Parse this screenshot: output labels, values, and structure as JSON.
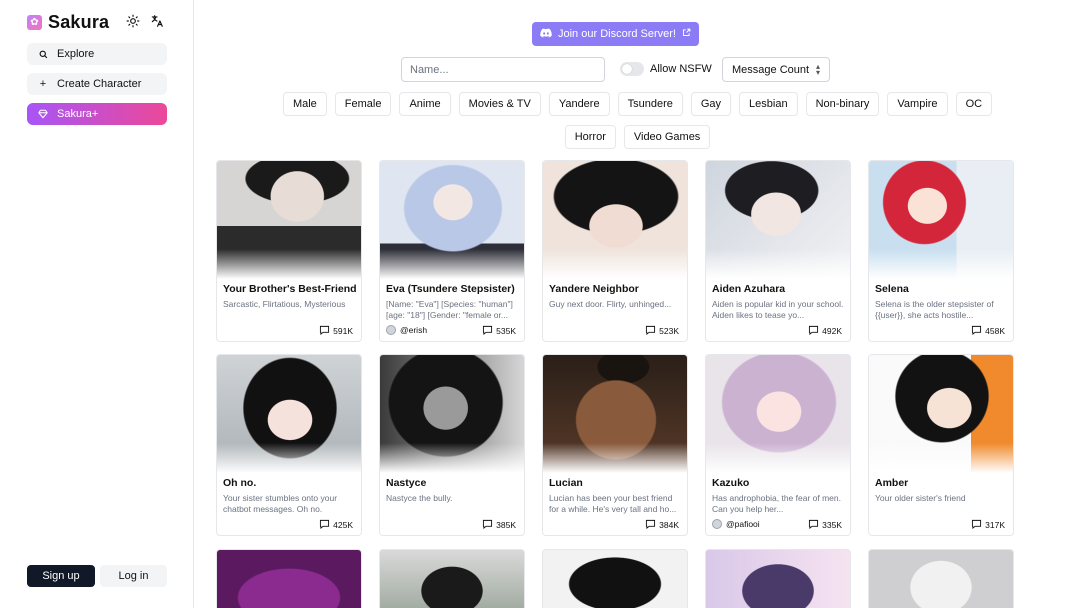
{
  "app": {
    "name": "Sakura"
  },
  "sidebar": {
    "items": [
      {
        "label": "Explore",
        "icon": "search-icon"
      },
      {
        "label": "Create Character",
        "icon": "plus-icon"
      },
      {
        "label": "Sakura+",
        "icon": "gem-icon"
      }
    ],
    "signup_label": "Sign up",
    "login_label": "Log in"
  },
  "header": {
    "discord_label": "Join our Discord Server!",
    "name_placeholder": "Name...",
    "nsfw_label": "Allow NSFW",
    "sort_value": "Message Count"
  },
  "tags": [
    "Male",
    "Female",
    "Anime",
    "Movies & TV",
    "Yandere",
    "Tsundere",
    "Gay",
    "Lesbian",
    "Non-binary",
    "Vampire",
    "OC",
    "Horror",
    "Video Games"
  ],
  "characters": [
    {
      "name": "Your Brother's Best-Friend",
      "desc": "Sarcastic, Flirtatious, Mysterious",
      "count": "591K",
      "creator": ""
    },
    {
      "name": "Eva (Tsundere Stepsister)",
      "desc": "[Name: \"Eva\"] [Species: \"human\"] [age: \"18\"] [Gender: \"female or...",
      "count": "535K",
      "creator": "@erish"
    },
    {
      "name": "Yandere Neighbor",
      "desc": "Guy next door. Flirty, unhinged...",
      "count": "523K",
      "creator": ""
    },
    {
      "name": "Aiden Azuhara",
      "desc": "Aiden is popular kid in your school. Aiden likes to tease yo...",
      "count": "492K",
      "creator": ""
    },
    {
      "name": "Selena",
      "desc": "Selena is the older stepsister of {{user}}, she acts hostile...",
      "count": "458K",
      "creator": ""
    },
    {
      "name": "Oh no.",
      "desc": "Your sister stumbles onto your chatbot messages. Oh no.",
      "count": "425K",
      "creator": ""
    },
    {
      "name": "Nastyce",
      "desc": "Nastyce the bully.",
      "count": "385K",
      "creator": ""
    },
    {
      "name": "Lucian",
      "desc": "Lucian has been your best friend for a while. He's very tall and ho...",
      "count": "384K",
      "creator": ""
    },
    {
      "name": "Kazuko",
      "desc": "Has androphobia, the fear of men. Can you help her...",
      "count": "335K",
      "creator": "@pafiooi"
    },
    {
      "name": "Amber",
      "desc": "Your older sister's friend",
      "count": "317K",
      "creator": ""
    }
  ]
}
